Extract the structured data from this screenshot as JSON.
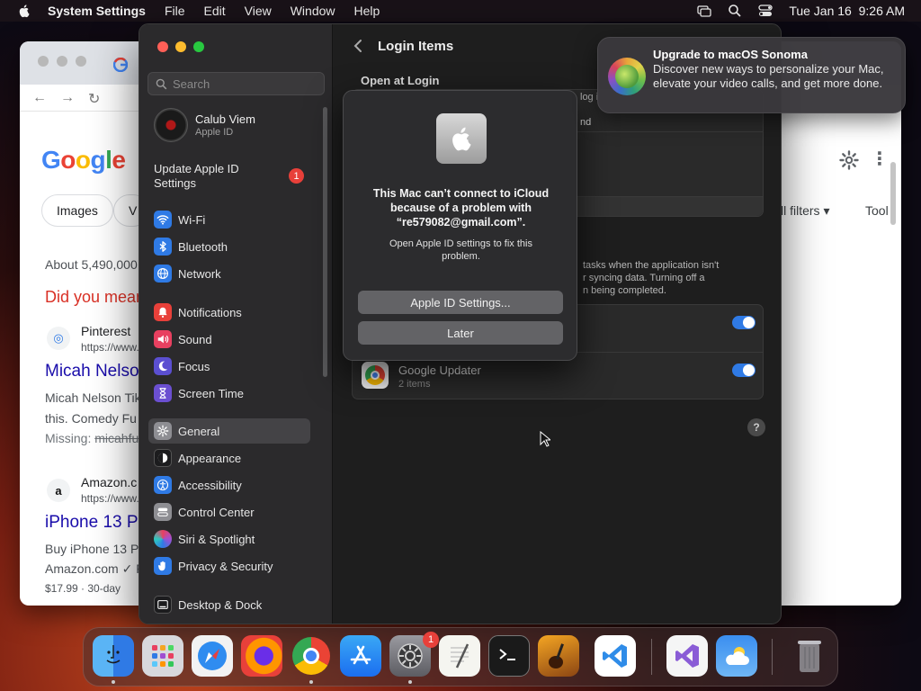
{
  "menubar": {
    "app_name": "System Settings",
    "menus": [
      "File",
      "Edit",
      "View",
      "Window",
      "Help"
    ],
    "datetime": "Tue Jan 16  9:26 AM"
  },
  "browser": {
    "logo": {
      "g": "G",
      "o1": "o",
      "o2": "o",
      "g2": "g",
      "l": "l",
      "e": "e"
    },
    "chips": [
      "Images",
      "V"
    ],
    "about": "About 5,490,000",
    "did_you_mean": "Did you mean",
    "result1": {
      "site": "Pinterest",
      "url": "https://www.",
      "title": "Micah Nelso",
      "snippet1": "Micah Nelson Tik",
      "snippet2": "this. Comedy Fu",
      "missing_label": "Missing:",
      "missing_term": "micahfu"
    },
    "result2": {
      "site": "Amazon.c",
      "url": "https://www.",
      "title": "iPhone 13 P",
      "snippet1": "Buy iPhone 13 P",
      "snippet2": "Amazon.com ✓ F",
      "snippet3": "$17.99 · 30-day"
    },
    "filters": "ll filters",
    "tools": "Tool"
  },
  "settings": {
    "search_placeholder": "Search",
    "account": {
      "name": "Calub Viem",
      "sub": "Apple ID"
    },
    "update": {
      "label": "Update Apple ID Settings",
      "badge": "1"
    },
    "sidebar": [
      {
        "label": "Wi-Fi",
        "color": "#2f7ae5",
        "icon": "wifi-icon"
      },
      {
        "label": "Bluetooth",
        "color": "#2f7ae5",
        "icon": "bluetooth-icon"
      },
      {
        "label": "Network",
        "color": "#2f7ae5",
        "icon": "globe-icon"
      },
      {
        "label": "Notifications",
        "color": "#e8403a",
        "icon": "bell-icon"
      },
      {
        "label": "Sound",
        "color": "#e84060",
        "icon": "speaker-icon"
      },
      {
        "label": "Focus",
        "color": "#5b4fd1",
        "icon": "moon-icon"
      },
      {
        "label": "Screen Time",
        "color": "#6b4fd1",
        "icon": "hourglass-icon"
      },
      {
        "label": "General",
        "color": "#8e8e93",
        "icon": "gear-icon"
      },
      {
        "label": "Appearance",
        "color": "#1c1c1e",
        "icon": "appearance-icon"
      },
      {
        "label": "Accessibility",
        "color": "#2f7ae5",
        "icon": "accessibility-icon"
      },
      {
        "label": "Control Center",
        "color": "#8e8e93",
        "icon": "control-center-icon"
      },
      {
        "label": "Siri & Spotlight",
        "color": "#a04fd1",
        "icon": "siri-icon"
      },
      {
        "label": "Privacy & Security",
        "color": "#2f7ae5",
        "icon": "hand-icon"
      },
      {
        "label": "Desktop & Dock",
        "color": "#1c1c1e",
        "icon": "dock-icon"
      }
    ],
    "selected": "General",
    "main": {
      "title": "Login Items",
      "section": "Open at Login",
      "peek_login": "log i",
      "peek_nd": "nd",
      "bg_text1": "tasks when the application isn't",
      "bg_text2": "r syncing data. Turning off a",
      "bg_text3": "n being completed.",
      "item": {
        "name": "Google Updater",
        "sub": "2 items"
      },
      "help": "?"
    }
  },
  "alert": {
    "title": "This Mac can’t connect to iCloud because of a problem with “re579082@gmail.com”.",
    "message": "Open Apple ID settings to fix this problem.",
    "primary": "Apple ID Settings...",
    "secondary": "Later"
  },
  "notification": {
    "title": "Upgrade to macOS Sonoma",
    "body": "Discover new ways to personalize your Mac, elevate your video calls, and get more done."
  },
  "dock": {
    "apps": [
      "Finder",
      "Launchpad",
      "Safari",
      "Firefox",
      "Chrome",
      "App Store",
      "System Settings",
      "TextEdit",
      "Terminal",
      "GarageBand",
      "VS Code",
      "Visual Studio",
      "Weather",
      "Trash"
    ],
    "settings_badge": "1"
  }
}
